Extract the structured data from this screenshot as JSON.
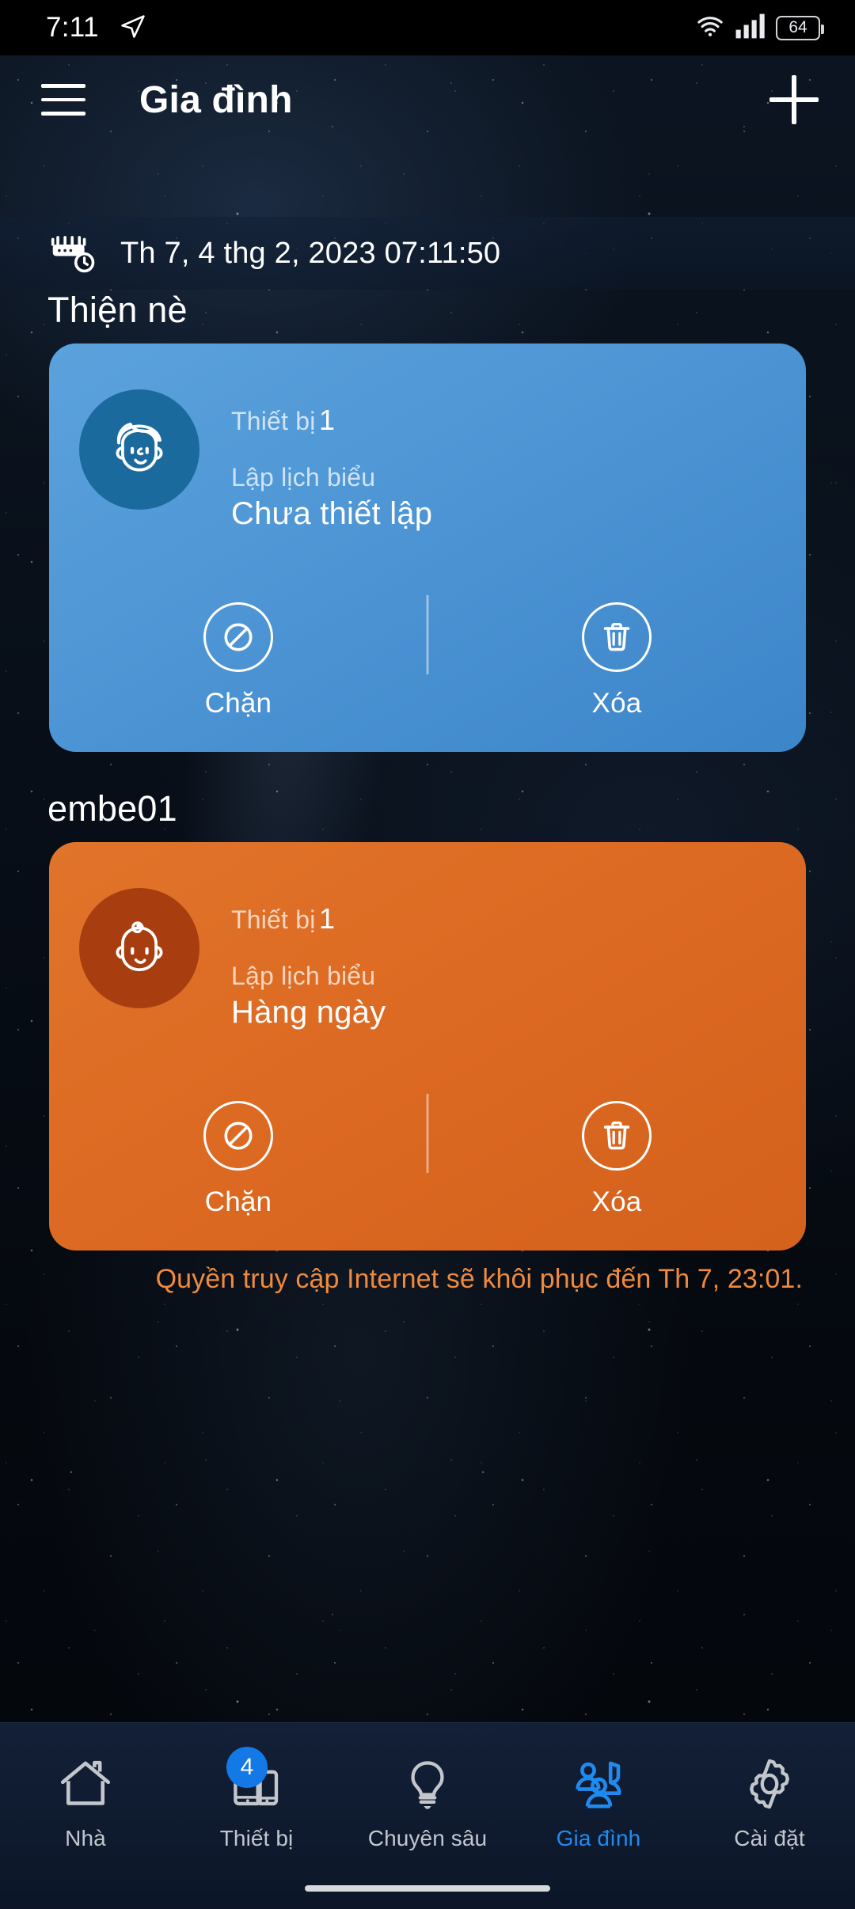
{
  "statusbar": {
    "time": "7:11",
    "telegram_icon": "send-icon",
    "wifi_icon": "wifi-icon",
    "signal_icon": "cellular-signal-icon",
    "battery_level": "64"
  },
  "appbar": {
    "menu_icon": "hamburger-menu-icon",
    "title": "Gia đình",
    "add_icon": "plus-icon"
  },
  "datebar": {
    "icon": "router-clock-icon",
    "text": "Th 7, 4 thg 2, 2023 07:11:50"
  },
  "profiles": [
    {
      "name": "Thiện nè",
      "theme": "blue",
      "accent": "#4d95d4",
      "avatar_bg": "#1b6a9e",
      "avatar_icon": "boy-face-icon",
      "devices_label": "Thiết bị",
      "devices_count": "1",
      "schedule_label": "Lập lịch biểu",
      "schedule_value": "Chưa thiết lập",
      "actions": [
        {
          "icon": "block-icon",
          "label": "Chặn"
        },
        {
          "icon": "trash-icon",
          "label": "Xóa"
        }
      ],
      "note": ""
    },
    {
      "name": "embe01",
      "theme": "orange",
      "accent": "#dd6a22",
      "avatar_bg": "#a83d10",
      "avatar_icon": "baby-face-icon",
      "devices_label": "Thiết bị",
      "devices_count": "1",
      "schedule_label": "Lập lịch biểu",
      "schedule_value": "Hàng ngày",
      "actions": [
        {
          "icon": "block-icon",
          "label": "Chặn"
        },
        {
          "icon": "trash-icon",
          "label": "Xóa"
        }
      ],
      "note": "Quyền truy cập Internet sẽ khôi phục đến Th 7, 23:01."
    }
  ],
  "bottomnav": {
    "items": [
      {
        "label": "Nhà",
        "icon": "home-icon",
        "active": false,
        "badge": ""
      },
      {
        "label": "Thiết bị",
        "icon": "devices-icon",
        "active": false,
        "badge": "4"
      },
      {
        "label": "Chuyên sâu",
        "icon": "lightbulb-icon",
        "active": false,
        "badge": ""
      },
      {
        "label": "Gia đình",
        "icon": "family-group-icon",
        "active": true,
        "badge": ""
      },
      {
        "label": "Cài đặt",
        "icon": "gear-icon",
        "active": false,
        "badge": ""
      }
    ]
  },
  "colors": {
    "active_nav": "#1f8bf0",
    "badge": "#1279e6",
    "note": "#f08a3c",
    "blue_card": "#4d95d4",
    "orange_card": "#dd6a22"
  }
}
